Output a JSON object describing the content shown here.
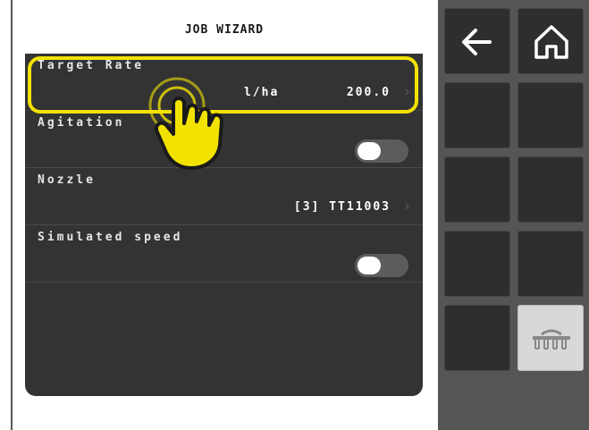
{
  "header": {
    "title": "JOB WIZARD"
  },
  "rows": [
    {
      "label": "Target Rate",
      "unit": "l/ha",
      "value": "200.0"
    },
    {
      "label": "Agitation",
      "toggle": "off"
    },
    {
      "label": "Nozzle",
      "value": "[3] TT11003"
    },
    {
      "label": "Simulated speed",
      "toggle": "off"
    }
  ],
  "sidebar": {
    "buttons": [
      {
        "icon": "back-arrow-icon"
      },
      {
        "icon": "home-icon"
      },
      {
        "icon": "sprayer-boom-icon"
      }
    ]
  },
  "colors": {
    "highlight": "#f2e200",
    "panel": "#333333",
    "sidebar": "#555555"
  }
}
